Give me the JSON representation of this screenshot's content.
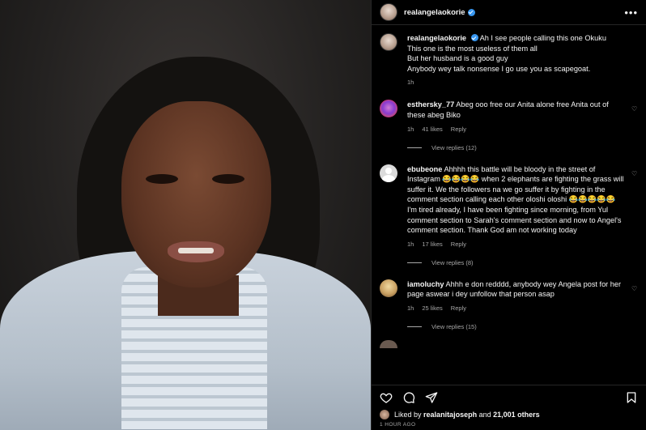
{
  "post": {
    "username": "realangelaokorie",
    "more_label": "•••"
  },
  "caption": {
    "username": "realangelaokorie",
    "lines": [
      "Ah I see people calling this one Okuku",
      "This one is the most useless of them all",
      "But her husband is a good guy",
      "Anybody wey talk nonsense I go use you as scapegoat."
    ],
    "time": "1h"
  },
  "comments": [
    {
      "username": "esthersky_77",
      "text": "Abeg ooo free our Anita alone free Anita out of these abeg Biko",
      "time": "1h",
      "likes": "41 likes",
      "reply": "Reply",
      "view_replies": "View replies (12)"
    },
    {
      "username": "ebubeone",
      "text": "Ahhhh this battle will be bloody in the street of Instagram 😂😂😂😂 when 2 elephants are fighting the grass will suffer it. We the followers na we go suffer it by fighting in the comment section calling each other oloshi oloshi 😂😂😂😂😂 I'm tired already, I have been fighting since morning, from Yul comment section to Sarah's comment section and now to Angel's comment section. Thank God am not working today",
      "time": "1h",
      "likes": "17 likes",
      "reply": "Reply",
      "view_replies": "View replies (8)"
    },
    {
      "username": "iamoluchy",
      "text": "Ahhh e don redddd, anybody wey Angela post for her page aswear i dey unfollow that person asap",
      "time": "1h",
      "likes": "25 likes",
      "reply": "Reply",
      "view_replies": "View replies (15)"
    }
  ],
  "liked_by": {
    "prefix": "Liked by",
    "user": "realanitajoseph",
    "middle": "and",
    "others": "21,001 others"
  },
  "time_ago": "1 HOUR AGO",
  "icons": [
    "heart-icon",
    "comment-icon",
    "share-icon",
    "bookmark-icon",
    "verified-icon"
  ],
  "colors": {
    "background": "#000000",
    "verified": "#3897f0",
    "muted": "#a8a8a8"
  }
}
